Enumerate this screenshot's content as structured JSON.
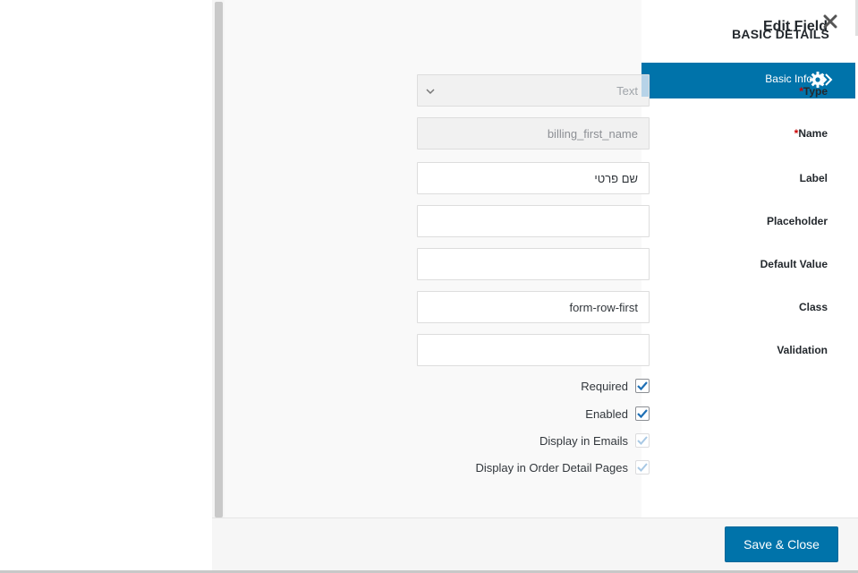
{
  "modal": {
    "title": "Edit Field",
    "section_title": "BASIC DETAILS",
    "close_icon": "close-icon"
  },
  "tabs": [
    {
      "label": "Basic Info",
      "icon": "gear-icon",
      "active": true
    }
  ],
  "fields": {
    "type": {
      "label": "Type",
      "required": true,
      "value": "Text"
    },
    "name": {
      "label": "Name",
      "required": true,
      "value": "billing_first_name"
    },
    "label": {
      "label": "Label",
      "value": "שם פרטי"
    },
    "placeholder": {
      "label": "Placeholder",
      "value": ""
    },
    "default_value": {
      "label": "Default Value",
      "value": ""
    },
    "class": {
      "label": "Class",
      "value": "form-row-first"
    },
    "validation": {
      "label": "Validation",
      "value": ""
    }
  },
  "required_marker": "*",
  "checkboxes": [
    {
      "label": "Required",
      "checked": true,
      "enabled": true
    },
    {
      "label": "Enabled",
      "checked": true,
      "enabled": true
    },
    {
      "label": "Display in Emails",
      "checked": true,
      "enabled": false
    },
    {
      "label": "Display in Order Detail Pages",
      "checked": true,
      "enabled": false
    }
  ],
  "footer": {
    "save_label": "Save & Close"
  },
  "colors": {
    "accent": "#0073aa",
    "check": "#1e6fb5",
    "check_faded": "#a8c8e4"
  }
}
